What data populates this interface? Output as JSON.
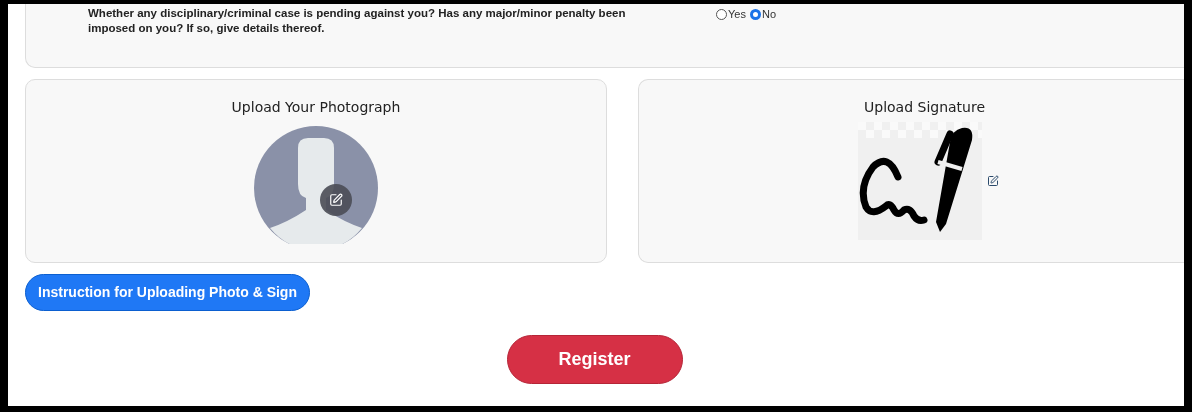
{
  "question": {
    "text": "Whether any disciplinary/criminal case is pending against you? Has any major/minor penalty been imposed on you? If so, give details thereof.",
    "options": [
      {
        "label": "Yes",
        "selected": false
      },
      {
        "label": "No",
        "selected": true
      }
    ]
  },
  "photo_card": {
    "title": "Upload Your Photograph"
  },
  "signature_card": {
    "title": "Upload Signature"
  },
  "instruction_button": "Instruction for Uploading Photo & Sign",
  "register_button": "Register"
}
